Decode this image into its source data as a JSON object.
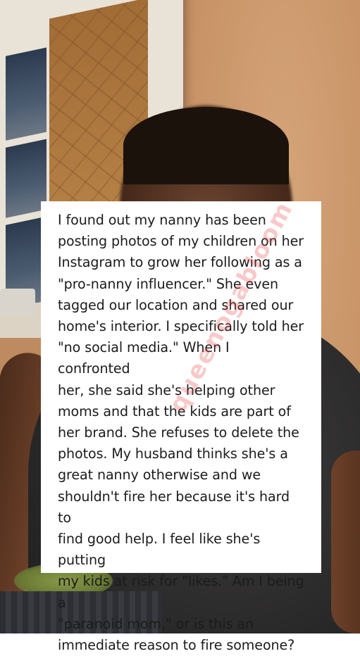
{
  "post": {
    "lines": [
      "I found out my nanny has been",
      "posting photos of my children on her",
      "Instagram to grow her following as a",
      "\"pro-nanny influencer.\" She even",
      "tagged our location and shared our",
      "home's interior. I specifically told her",
      "\"no social media.\" When I confronted",
      "her, she said she's helping other",
      "moms and that the kids are part of",
      "her brand. She refuses to delete the",
      "photos. My husband thinks she's a",
      "great nanny otherwise and we",
      "shouldn't fire her because it's hard to",
      "find good help. I feel like she's putting",
      "my kids at risk for \"likes.\" Am I being a",
      "\"paranoid mom,\" or is this an",
      "immediate reason to fire someone?"
    ],
    "watermark": "queenogabloom"
  },
  "colors": {
    "card_background": "#ffffff",
    "text": "#1b1b1b",
    "watermark": "#e83e3e"
  }
}
